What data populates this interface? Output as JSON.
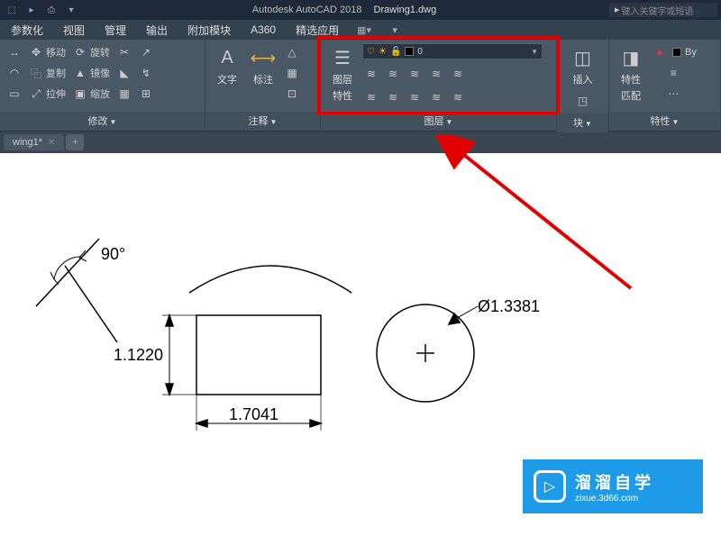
{
  "title": {
    "app": "Autodesk AutoCAD 2018",
    "file": "Drawing1.dwg"
  },
  "search": {
    "placeholder": "键入关键字或短语"
  },
  "menu": {
    "items": [
      "参数化",
      "视图",
      "管理",
      "输出",
      "附加模块",
      "A360",
      "精选应用"
    ]
  },
  "ribbon": {
    "modify": {
      "title": "修改",
      "move": "移动",
      "copy": "复制",
      "stretch": "拉伸",
      "rotate": "旋转",
      "mirror": "镜像",
      "scale": "缩放"
    },
    "annot": {
      "title": "注释",
      "text": "文字",
      "dim": "标注"
    },
    "layers": {
      "title": "图层",
      "props_lbl1": "图层",
      "props_lbl2": "特性",
      "dropdown": {
        "name": "0"
      }
    },
    "block": {
      "title": "块",
      "insert": "插入"
    },
    "props": {
      "title": "特性",
      "match": "特性",
      "match2": "匹配",
      "bylayer": "By"
    }
  },
  "doc_tab": {
    "name": "wing1*"
  },
  "drawing": {
    "angle": "90°",
    "rect_h": "1.1220",
    "rect_w": "1.7041",
    "circle_d": "Ø1.3381"
  },
  "watermark": {
    "brand": "溜溜自学",
    "url": "zixue.3d66.com"
  }
}
